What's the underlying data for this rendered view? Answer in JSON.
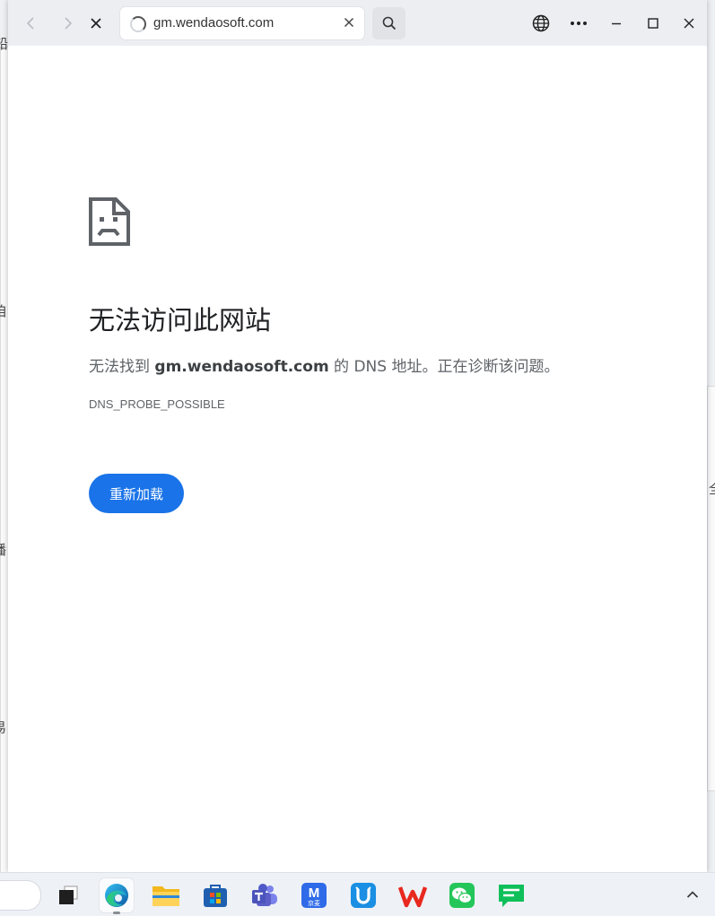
{
  "browser": {
    "url": "gm.wendaosoft.com"
  },
  "error": {
    "title": "无法访问此网站",
    "desc_prefix": "无法找到 ",
    "desc_host": "gm.wendaosoft.com",
    "desc_suffix": " 的 DNS 地址。正在诊断该问题。",
    "code": "DNS_PROBE_POSSIBLE",
    "reload_label": "重新加载"
  },
  "background": {
    "left_glyphs": [
      "铅",
      "咱",
      "播",
      "易"
    ],
    "right_glyphs": [
      "全"
    ]
  },
  "taskbar": {
    "jd_label": "京麦",
    "jd_letter": "M"
  },
  "colors": {
    "accent": "#1a73e8",
    "titlebar": "#eceef2"
  }
}
